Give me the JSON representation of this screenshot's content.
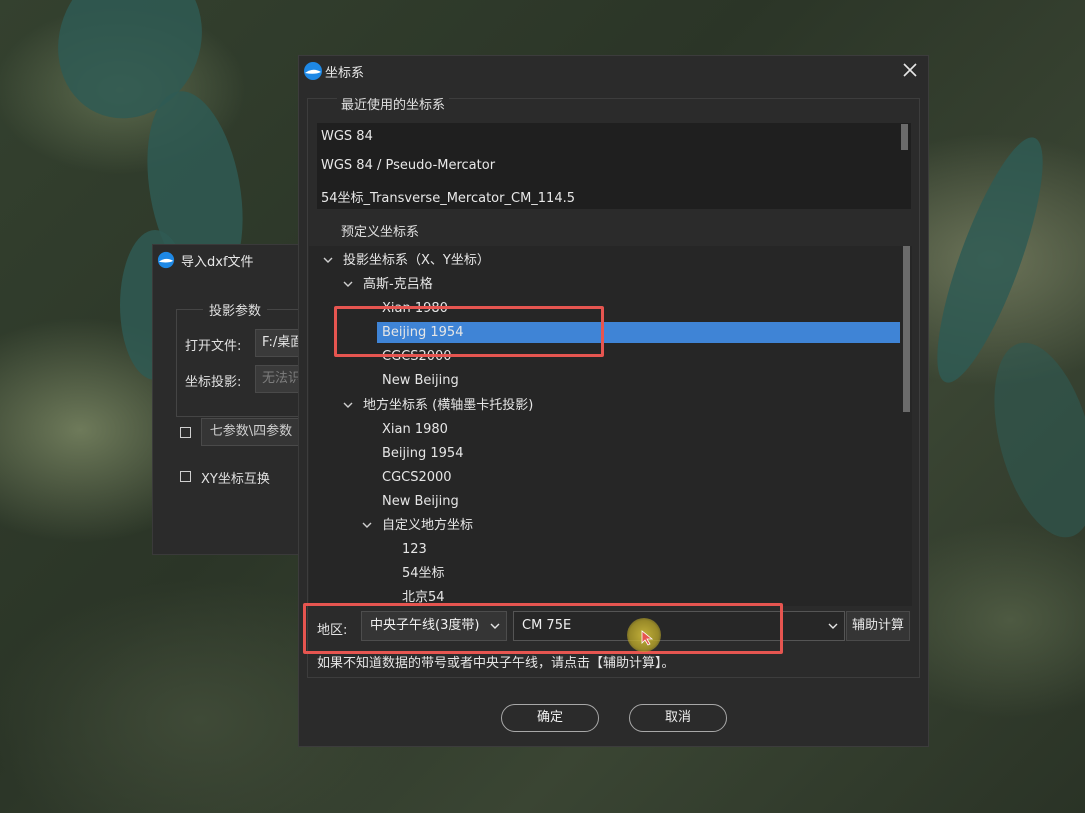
{
  "import_dialog": {
    "title": "导入dxf文件",
    "group_title": "投影参数",
    "open_file_label": "打开文件:",
    "open_file_value": "F:/桌面",
    "projection_label": "坐标投影:",
    "projection_placeholder": "无法识",
    "seven_param_button": "七参数\\四参数",
    "xy_swap_label": "XY坐标互换"
  },
  "crs_dialog": {
    "title": "坐标系",
    "recent_title": "最近使用的坐标系",
    "recent_items": [
      "WGS 84",
      "WGS 84 / Pseudo-Mercator",
      "54坐标_Transverse_Mercator_CM_114.5"
    ],
    "predefined_title": "预定义坐标系",
    "tree": [
      {
        "label": "投影坐标系（X、Y坐标）",
        "expanded": true,
        "level": 0
      },
      {
        "label": "高斯-克吕格",
        "expanded": true,
        "level": 1
      },
      {
        "label": "Xian 1980",
        "level": 2
      },
      {
        "label": "Beijing 1954",
        "level": 2,
        "selected": true
      },
      {
        "label": "CGCS2000",
        "level": 2
      },
      {
        "label": "New Beijing",
        "level": 2
      },
      {
        "label": "地方坐标系 (横轴墨卡托投影)",
        "expanded": true,
        "level": 1
      },
      {
        "label": "Xian 1980",
        "level": 2
      },
      {
        "label": "Beijing 1954",
        "level": 2
      },
      {
        "label": "CGCS2000",
        "level": 2
      },
      {
        "label": "New Beijing",
        "level": 2
      },
      {
        "label": "自定义地方坐标",
        "expanded": true,
        "level": 2
      },
      {
        "label": "123",
        "level": 3
      },
      {
        "label": "54坐标",
        "level": 3
      },
      {
        "label": "北京54",
        "level": 3
      }
    ],
    "region_label": "地区:",
    "meridian_select": "中央子午线(3度带)",
    "cm_select": "CM 75E",
    "aux_button": "辅助计算",
    "hint": "如果不知道数据的带号或者中央子午线，请点击【辅助计算】。",
    "ok_button": "确定",
    "cancel_button": "取消"
  },
  "colors": {
    "selection": "#3f84d6",
    "highlight_box": "#e65550",
    "dialog_bg": "#2b2b2b",
    "list_bg": "#1f1f1f"
  }
}
